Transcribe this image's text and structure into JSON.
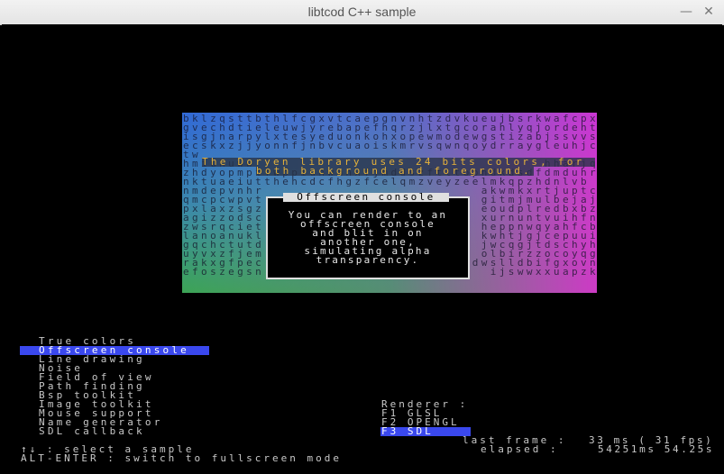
{
  "window": {
    "title": "libtcod C++ sample",
    "minimize_glyph": "—",
    "close_glyph": "✕"
  },
  "panel": {
    "rows": [
      "bklzqsttbthlfcgxvtcaepgnvnhtzdvkueujbsrkwafcpx",
      "gvechdtieleuwjyrebapefhqrzjlxtgcorahlyqjordeht",
      "isgjnarpylxtesyeduonkohxopewmodewgstizabjssvvs",
      "ecskxzjjyonnfjnbvcuaoiskmrvsqwnqoydrraygleuhjc",
      "tw                                            ",
      "hmiuhuww                                hharjqi",
      "zhdyopmptfwppiunwmhxfjmddszftltophdkdsdfdmduhru",
      "nktuaeiutthehcdcfhgzfcelqmzveyzeelmkqpzhdnlvb",
      "nmdepvnhr                        akwmkxrtjuptcp",
      "qmcpcwpvt                        gitmjmulbejajw",
      "pxlaxzsgz                        eoudplredbxbzl",
      "agizzodsc                        xurnuntvuihfnz",
      "zwsrqciet                        heppnwqyahfcbw",
      "lanoanukl                        kwhtjgjcepuuit",
      "gqchctutd                        jwcqgjtdschyhi",
      "uyvxzfjem                        olbirzzocoyqge",
      "rakxgfpec vmvgpzhoeeuhetsyvenhdpdwslldbifgxovno",
      "efoszegsn                         ijswwxxuapzkib"
    ],
    "banner_line1": "The Doryen library uses 24 bits colors, for",
    "banner_line2": "both background and foreground."
  },
  "offscreen": {
    "title": "Offscreen console",
    "lines": [
      "You can render to an",
      "offscreen console",
      "and blit in on",
      "another one,",
      "simulating alpha",
      "transparency."
    ]
  },
  "menu": {
    "items": [
      "True colors",
      "Offscreen console",
      "Line drawing",
      "Noise",
      "Field of view",
      "Path finding",
      "Bsp toolkit",
      "Image toolkit",
      "Mouse support",
      "Name generator",
      "SDL callback"
    ],
    "selected_index": 1
  },
  "renderer": {
    "header": "Renderer :",
    "options": [
      "F1 GLSL",
      "F2 OPENGL",
      "F3 SDL"
    ],
    "selected_index": 2
  },
  "stats": {
    "last_frame_label": "last frame :",
    "last_frame_value": "33 ms ( 31 fps)",
    "elapsed_label": "elapsed :",
    "elapsed_value": "54251ms 54.25s"
  },
  "help": {
    "select_hint": "↑↓ : select a sample",
    "fullscreen_hint": "ALT-ENTER : switch to fullscreen mode"
  }
}
